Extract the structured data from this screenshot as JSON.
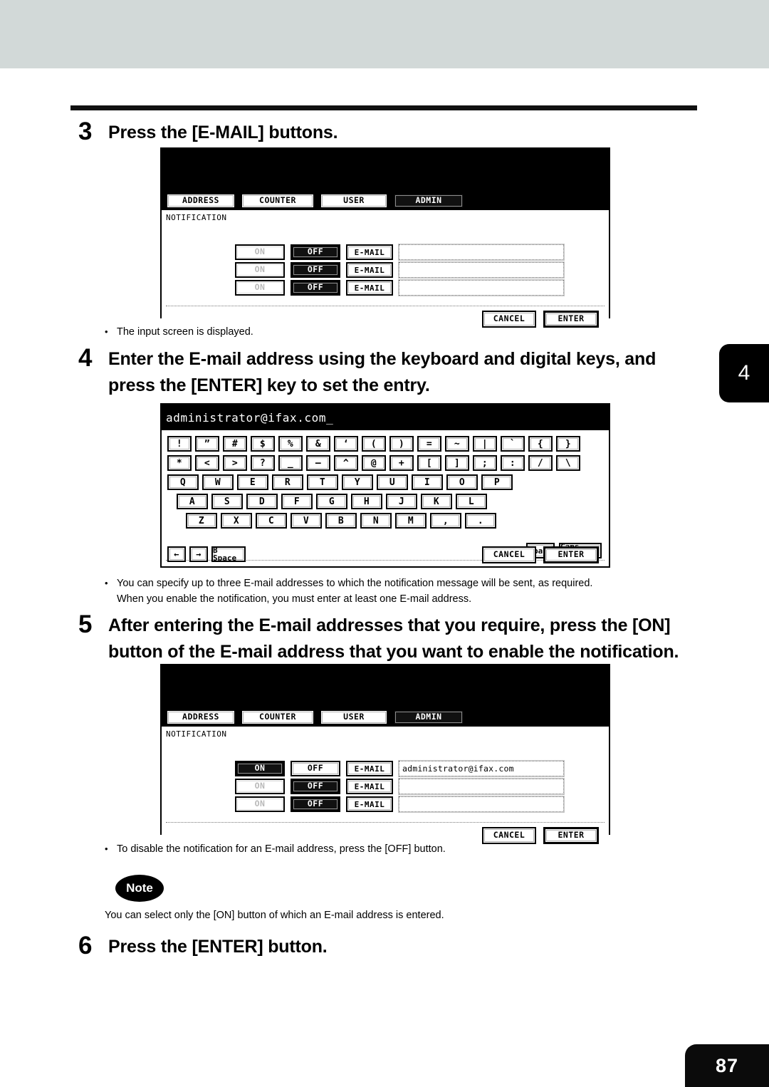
{
  "page": {
    "chapter_tab": "4",
    "page_number": "87"
  },
  "steps": [
    {
      "number": "3",
      "text": "Press the [E-MAIL] buttons."
    },
    {
      "number": "4",
      "line1": "Enter the E-mail address using the keyboard and digital keys, and",
      "line2": "press the [ENTER] key to set the entry."
    },
    {
      "number": "5",
      "line1": "After entering the E-mail addresses that you require, press the [ON]",
      "line2": "button of the E-mail address that you want to enable the notification."
    },
    {
      "number": "6",
      "text": "Press the [ENTER] button."
    }
  ],
  "bullets": {
    "after_step3": "The input screen is displayed.",
    "after_step4_line1": "You can specify up to three E-mail addresses to which the notification message will be sent, as required.",
    "after_step4_line2": "When you enable the notification, you must enter at least one E-mail address.",
    "after_step5": "To disable the notification for an E-mail address, press the [OFF] button.",
    "dot": "•"
  },
  "note": {
    "badge": "Note",
    "text": "You can select only the [ON] button of which an E-mail address is entered."
  },
  "panel_notification_off": {
    "tabs": [
      {
        "label": "ADDRESS",
        "selected": false
      },
      {
        "label": "COUNTER",
        "selected": false
      },
      {
        "label": "USER",
        "selected": false
      },
      {
        "label": "ADMIN",
        "selected": true
      }
    ],
    "screen_title": "NOTIFICATION",
    "rows": [
      {
        "on_label": "ON",
        "off_label": "OFF",
        "mail_label": "E-MAIL",
        "address": "",
        "state": "off"
      },
      {
        "on_label": "ON",
        "off_label": "OFF",
        "mail_label": "E-MAIL",
        "address": "",
        "state": "off"
      },
      {
        "on_label": "ON",
        "off_label": "OFF",
        "mail_label": "E-MAIL",
        "address": "",
        "state": "off"
      }
    ],
    "cancel_label": "CANCEL",
    "enter_label": "ENTER"
  },
  "panel_keyboard": {
    "display_value": "administrator@ifax.com",
    "cursor": "_",
    "rows": {
      "symbols1": [
        "!",
        "”",
        "#",
        "$",
        "%",
        "&",
        "‘",
        "(",
        ")",
        "=",
        "~",
        "|",
        "`",
        "{",
        "}"
      ],
      "symbols2": [
        "*",
        "<",
        ">",
        "?",
        "_",
        "—",
        "^",
        "@",
        "+",
        "[",
        "]",
        ";",
        ":",
        "/",
        "\\"
      ],
      "letters1": [
        "Q",
        "W",
        "E",
        "R",
        "T",
        "Y",
        "U",
        "I",
        "O",
        "P"
      ],
      "letters2": [
        "A",
        "S",
        "D",
        "F",
        "G",
        "H",
        "J",
        "K",
        "L"
      ],
      "letters3": [
        "Z",
        "X",
        "C",
        "V",
        "B",
        "N",
        "M",
        ",",
        "."
      ]
    },
    "space_label": "Space",
    "caps_lock_label": "Caps Lock",
    "left_arrow": "←",
    "right_arrow": "→",
    "bspace_label": "B Space",
    "cancel_label": "CANCEL",
    "enter_label": "ENTER"
  },
  "panel_notification_on": {
    "tabs": [
      {
        "label": "ADDRESS",
        "selected": false
      },
      {
        "label": "COUNTER",
        "selected": false
      },
      {
        "label": "USER",
        "selected": false
      },
      {
        "label": "ADMIN",
        "selected": true
      }
    ],
    "screen_title": "NOTIFICATION",
    "rows": [
      {
        "on_label": "ON",
        "off_label": "OFF",
        "mail_label": "E-MAIL",
        "address": "administrator@ifax.com",
        "state": "on"
      },
      {
        "on_label": "ON",
        "off_label": "OFF",
        "mail_label": "E-MAIL",
        "address": "",
        "state": "off"
      },
      {
        "on_label": "ON",
        "off_label": "OFF",
        "mail_label": "E-MAIL",
        "address": "",
        "state": "off"
      }
    ],
    "cancel_label": "CANCEL",
    "enter_label": "ENTER"
  },
  "colors": {
    "top_band": "#d2d9d8",
    "ink": "#000000",
    "paper": "#ffffff"
  }
}
